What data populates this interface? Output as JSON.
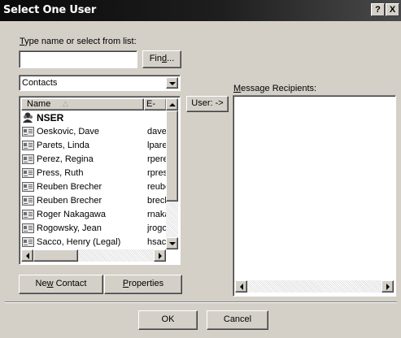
{
  "window": {
    "title": "Select One User",
    "help_glyph": "?",
    "close_glyph": "X"
  },
  "search": {
    "label_prefix": "T",
    "label_rest": "ype name or select from list:",
    "value": "",
    "find_prefix": "Fin",
    "find_underlined": "d",
    "find_suffix": "..."
  },
  "address_book": {
    "selected": "Contacts"
  },
  "list": {
    "columns": {
      "name": "Name",
      "email": "E-Ma"
    },
    "group_row": "NSER",
    "rows": [
      {
        "name": "Oeskovic, Dave",
        "email": "dave"
      },
      {
        "name": "Parets, Linda",
        "email": "lpare"
      },
      {
        "name": "Perez, Regina",
        "email": "rpere"
      },
      {
        "name": "Press, Ruth",
        "email": "rpres"
      },
      {
        "name": "Reuben Brecher",
        "email": "reube"
      },
      {
        "name": "Reuben Brecher",
        "email": "brech"
      },
      {
        "name": "Roger Nakagawa",
        "email": "rnaka"
      },
      {
        "name": "Rogowsky, Jean",
        "email": "jrogo"
      },
      {
        "name": "Sacco, Henry (Legal)",
        "email": "hsac"
      }
    ]
  },
  "buttons": {
    "user_arrow": "User: ->",
    "new_contact_prefix": "Ne",
    "new_contact_underlined": "w",
    "new_contact_suffix": " Contact",
    "properties_underlined": "P",
    "properties_suffix": "roperties",
    "ok": "OK",
    "cancel": "Cancel"
  },
  "recipients": {
    "label_underlined": "M",
    "label_rest": "essage Recipients:"
  }
}
